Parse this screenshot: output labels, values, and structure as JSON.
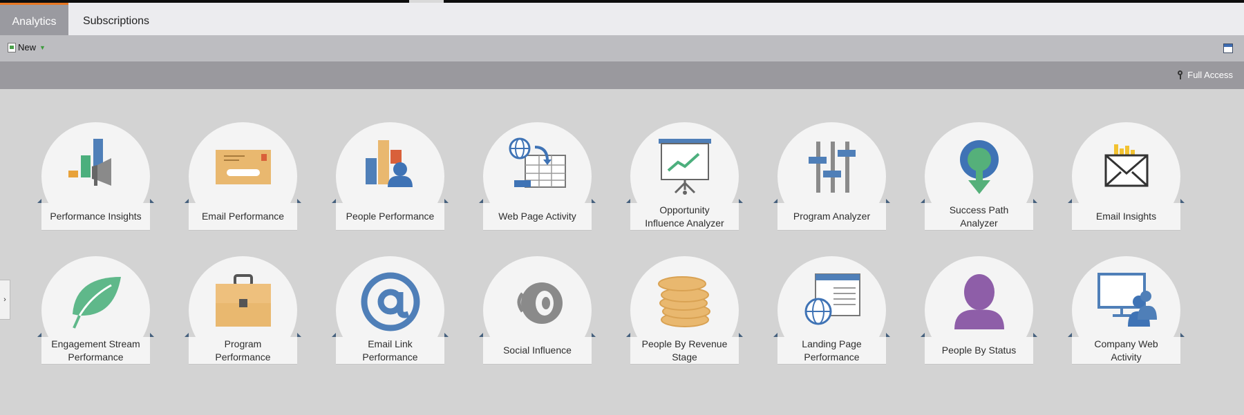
{
  "tabs": [
    {
      "label": "Analytics",
      "active": true
    },
    {
      "label": "Subscriptions",
      "active": false
    }
  ],
  "toolbar": {
    "new_label": "New",
    "new_icon": "new-document-icon",
    "window_icon": "maximize-window-icon"
  },
  "access": {
    "label": "Full Access",
    "icon": "key-icon"
  },
  "side_handle": {
    "label": "›"
  },
  "colors": {
    "accent": "#e87722",
    "tab_active_bg": "#9a9aa0",
    "ribbon_corner": "#45607d",
    "background": "#d3d3d3"
  },
  "tiles": [
    {
      "label": "Performance Insights",
      "icon": "performance-insights-icon"
    },
    {
      "label": "Email Performance",
      "icon": "email-performance-icon"
    },
    {
      "label": "People Performance",
      "icon": "people-performance-icon"
    },
    {
      "label": "Web Page Activity",
      "icon": "web-page-activity-icon"
    },
    {
      "label": "Opportunity\nInfluence Analyzer",
      "icon": "opportunity-influence-analyzer-icon"
    },
    {
      "label": "Program Analyzer",
      "icon": "program-analyzer-icon"
    },
    {
      "label": "Success Path\nAnalyzer",
      "icon": "success-path-analyzer-icon"
    },
    {
      "label": "Email Insights",
      "icon": "email-insights-icon"
    },
    {
      "label": "Engagement Stream\nPerformance",
      "icon": "engagement-stream-performance-icon"
    },
    {
      "label": "Program\nPerformance",
      "icon": "program-performance-icon"
    },
    {
      "label": "Email Link\nPerformance",
      "icon": "email-link-performance-icon"
    },
    {
      "label": "Social Influence",
      "icon": "social-influence-icon"
    },
    {
      "label": "People By Revenue\nStage",
      "icon": "people-by-revenue-stage-icon"
    },
    {
      "label": "Landing Page\nPerformance",
      "icon": "landing-page-performance-icon"
    },
    {
      "label": "People By Status",
      "icon": "people-by-status-icon"
    },
    {
      "label": "Company Web\nActivity",
      "icon": "company-web-activity-icon"
    }
  ]
}
